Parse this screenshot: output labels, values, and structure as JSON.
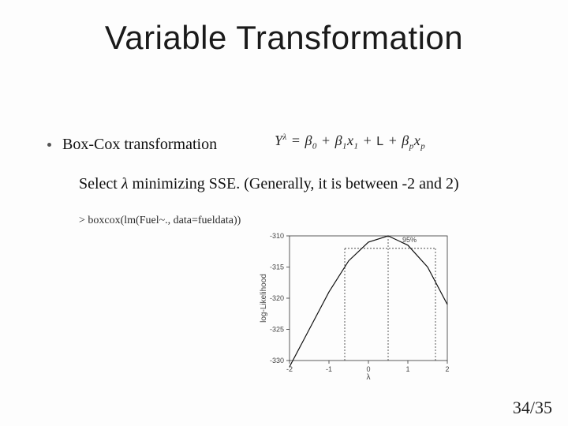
{
  "title": "Variable Transformation",
  "bullet": {
    "label": "Box-Cox transformation"
  },
  "formula": {
    "lhs_var": "Y",
    "lhs_exp": "λ",
    "eq": " = ",
    "b0": "β",
    "b0s": "0",
    "plus1": " + ",
    "b1": "β",
    "b1s": "1",
    "x1": "x",
    "x1s": "1",
    "plus2": " + ",
    "ellipsis": "L",
    "plus3": " + ",
    "bp": "β",
    "bps": "p",
    "xp": "x",
    "xps": "p"
  },
  "select_line": {
    "pre": "Select ",
    "lambda": "λ",
    "post": "  minimizing SSE. (Generally, it is between -2 and 2)"
  },
  "code_line": "> boxcox(lm(Fuel~., data=fueldata))",
  "page": "34/35",
  "chart_data": {
    "type": "line",
    "title": "",
    "xlabel": "λ",
    "ylabel": "log-Likelihood",
    "xlim": [
      -2,
      2
    ],
    "ylim": [
      -330,
      -310
    ],
    "conf_level_label": "95%",
    "x": [
      -2.0,
      -1.5,
      -1.0,
      -0.5,
      0.0,
      0.5,
      1.0,
      1.5,
      2.0
    ],
    "y": [
      -331,
      -325,
      -319,
      -314,
      -311,
      -310,
      -311.5,
      -315,
      -321
    ],
    "conf_interval_x": [
      -0.6,
      1.7
    ],
    "conf_cut_y": -312,
    "ticks_x": [
      -2,
      -1,
      0,
      1,
      2
    ],
    "ticks_y": [
      -330,
      -325,
      -320,
      -315,
      -310
    ]
  }
}
